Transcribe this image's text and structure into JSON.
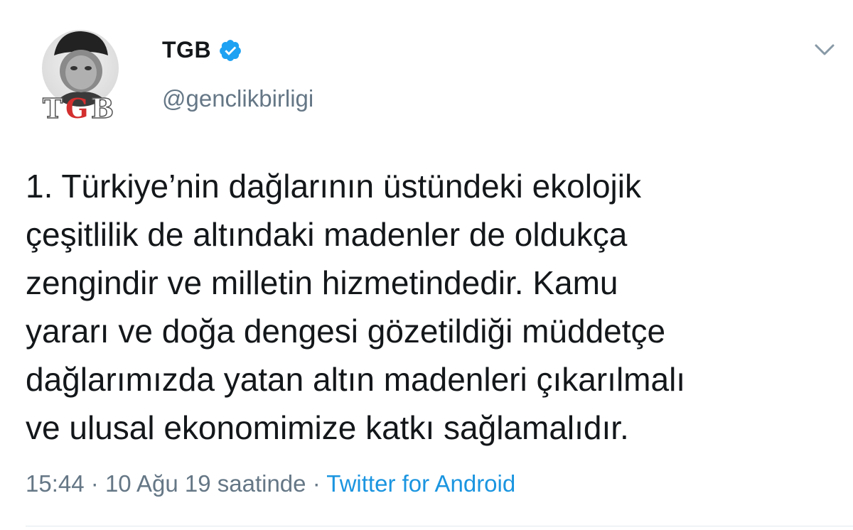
{
  "tweet": {
    "author": {
      "display_name": "TGB",
      "handle": "@genclikbirligi",
      "verified": true,
      "avatar_text": "TGB"
    },
    "text": "1. Türkiye’nin dağlarının üstündeki ekolojik\nçeşitlilik de altındaki madenler de oldukça\nzengindir ve milletin hizmetindedir. Kamu\nyararı ve doğa dengesi gözetildiği müddetçe\ndağlarımızda yatan altın madenleri çıkarılmalı\nve ulusal ekonomimize katkı sağlamalıdır.",
    "time": "15:44",
    "date": "10 Ağu 19 saatinde",
    "separator": " · ",
    "source": "Twitter for Android"
  },
  "icons": {
    "verified": "verified-badge-icon",
    "menu": "chevron-down-icon"
  },
  "colors": {
    "verified": "#1da1f2",
    "link": "#1b95e0",
    "secondary_text": "#657786",
    "primary_text": "#14171a"
  }
}
